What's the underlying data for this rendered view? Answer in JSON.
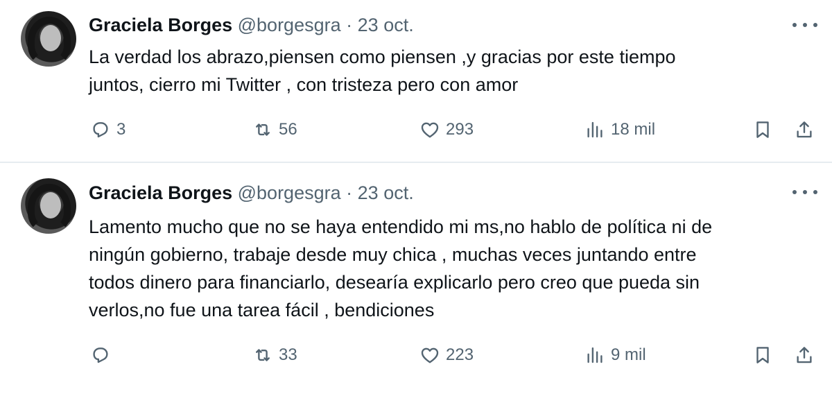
{
  "tweets": [
    {
      "author_name": "Graciela Borges",
      "handle": "@borgesgra",
      "separator": "·",
      "date": "23 oct.",
      "text": "La verdad los abrazo,piensen como piensen ,y gracias por este tiempo\njuntos, cierro mi Twitter , con tristeza pero con amor",
      "replies": "3",
      "retweets": "56",
      "likes": "293",
      "views": "18 mil"
    },
    {
      "author_name": "Graciela Borges",
      "handle": "@borgesgra",
      "separator": "·",
      "date": "23 oct.",
      "text": "Lamento mucho que no se haya entendido mi ms,no hablo de política ni de\nningún gobierno, trabaje desde muy chica , muchas veces juntando entre\ntodos dinero para financiarlo, desearía explicarlo pero creo que pueda sin\nverlos,no fue una tarea fácil , bendiciones",
      "replies": "",
      "retweets": "33",
      "likes": "223",
      "views": "9 mil"
    }
  ],
  "icons": {
    "reply": "reply-icon",
    "retweet": "retweet-icon",
    "like": "heart-icon",
    "views": "views-icon",
    "bookmark": "bookmark-icon",
    "share": "share-icon",
    "more": "more-icon"
  },
  "colors": {
    "text": "#0f1419",
    "secondary": "#536471",
    "divider": "#e6ecf0"
  }
}
